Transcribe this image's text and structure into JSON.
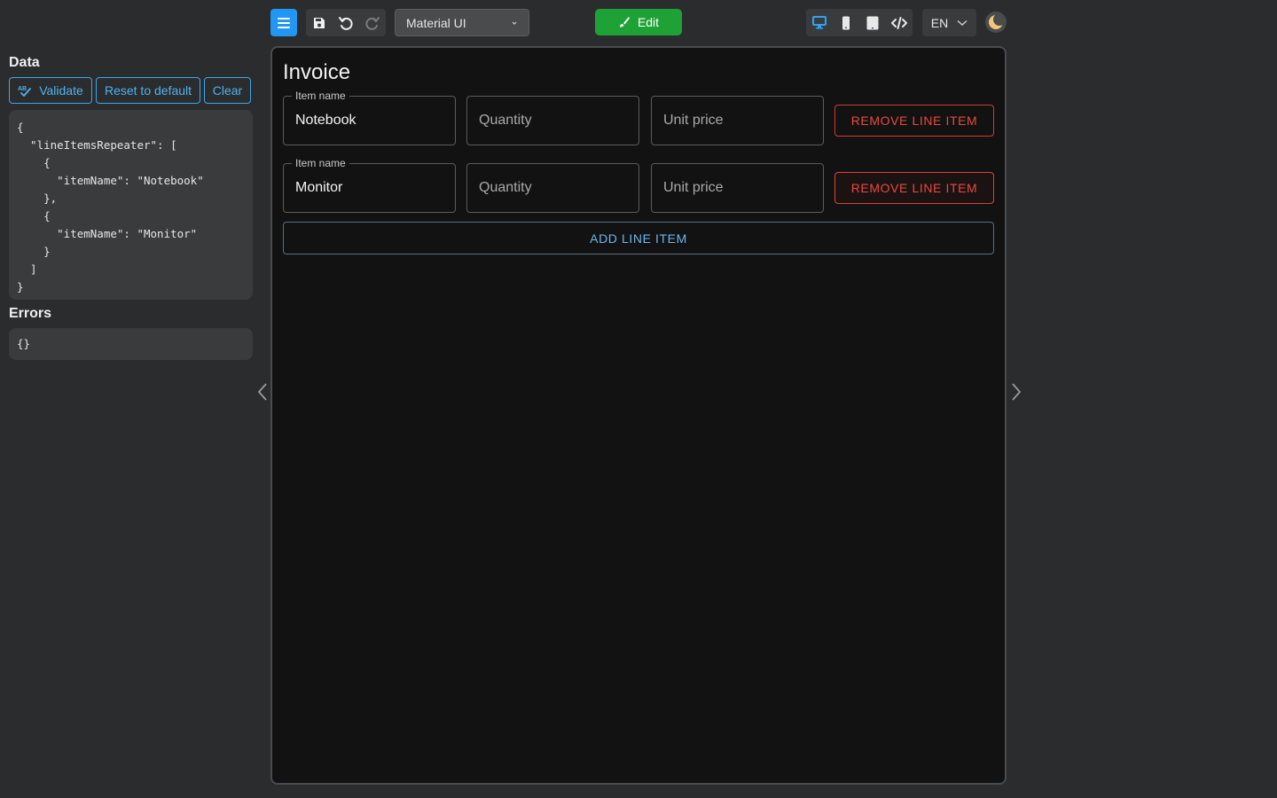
{
  "toolbar": {
    "theme_select": "Material UI",
    "edit_label": "Edit",
    "language": "EN"
  },
  "left_panel": {
    "data_title": "Data",
    "validate_label": "Validate",
    "reset_label": "Reset to default",
    "clear_label": "Clear",
    "data_json": "{\n  \"lineItemsRepeater\": [\n    {\n      \"itemName\": \"Notebook\"\n    },\n    {\n      \"itemName\": \"Monitor\"\n    }\n  ]\n}",
    "errors_title": "Errors",
    "errors_json": "{}"
  },
  "form": {
    "title": "Invoice",
    "line_items": [
      {
        "item_name_label": "Item name",
        "item_name_value": "Notebook",
        "quantity_placeholder": "Quantity",
        "unit_price_placeholder": "Unit price",
        "remove_label": "REMOVE LINE ITEM"
      },
      {
        "item_name_label": "Item name",
        "item_name_value": "Monitor",
        "quantity_placeholder": "Quantity",
        "unit_price_placeholder": "Unit price",
        "remove_label": "REMOVE LINE ITEM"
      }
    ],
    "add_label": "ADD LINE ITEM"
  },
  "colors": {
    "accent": "#2196f3",
    "edit": "#1fa235",
    "danger": "#e04036"
  }
}
